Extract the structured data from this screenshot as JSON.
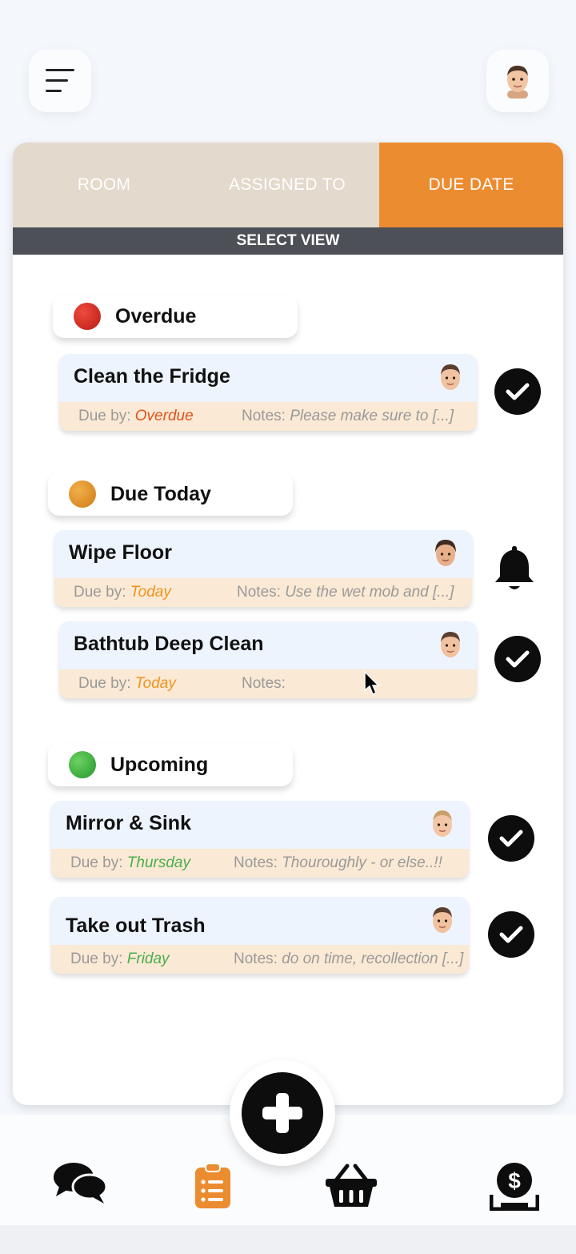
{
  "icons": {
    "menu": "menu-icon",
    "profile": "avatar",
    "check": "checkmark-icon",
    "bell": "bell-icon",
    "add": "plus-icon",
    "chat": "chat-bubbles-icon",
    "tasks": "clipboard-list-icon",
    "shop": "basket-icon",
    "money": "dollar-coin-icon"
  },
  "colors": {
    "accent": "#ec8c30",
    "overdue": "#d4251c",
    "today": "#e38e25",
    "upcoming": "#2faa3a",
    "overdue_text": "#e0531d",
    "today_text": "#f0921e",
    "upcoming_text": "#4bae4f"
  },
  "tabs": [
    {
      "label": "ROOM",
      "active": false
    },
    {
      "label": "ASSIGNED TO",
      "active": false
    },
    {
      "label": "DUE DATE",
      "active": true
    }
  ],
  "select_view": "SELECT VIEW",
  "sections": {
    "overdue": {
      "label": "Overdue"
    },
    "today": {
      "label": "Due Today"
    },
    "upcoming": {
      "label": "Upcoming"
    }
  },
  "due_prefix": "Due by:",
  "notes_prefix": "Notes:",
  "tasks": [
    {
      "title": "Clean the Fridge",
      "due": "Overdue",
      "notes": "Please make sure to [...]",
      "action": "check"
    },
    {
      "title": "Wipe Floor",
      "due": "Today",
      "notes": "Use the wet mob and [...]",
      "action": "bell"
    },
    {
      "title": "Bathtub Deep Clean",
      "due": "Today",
      "notes": "",
      "action": "check"
    },
    {
      "title": "Mirror & Sink",
      "due": "Thursday",
      "notes": "Thouroughly - or else..!!",
      "action": "check"
    },
    {
      "title": "Take out Trash",
      "due": "Friday",
      "notes": "do on time, recollection [...]",
      "action": "check"
    }
  ]
}
